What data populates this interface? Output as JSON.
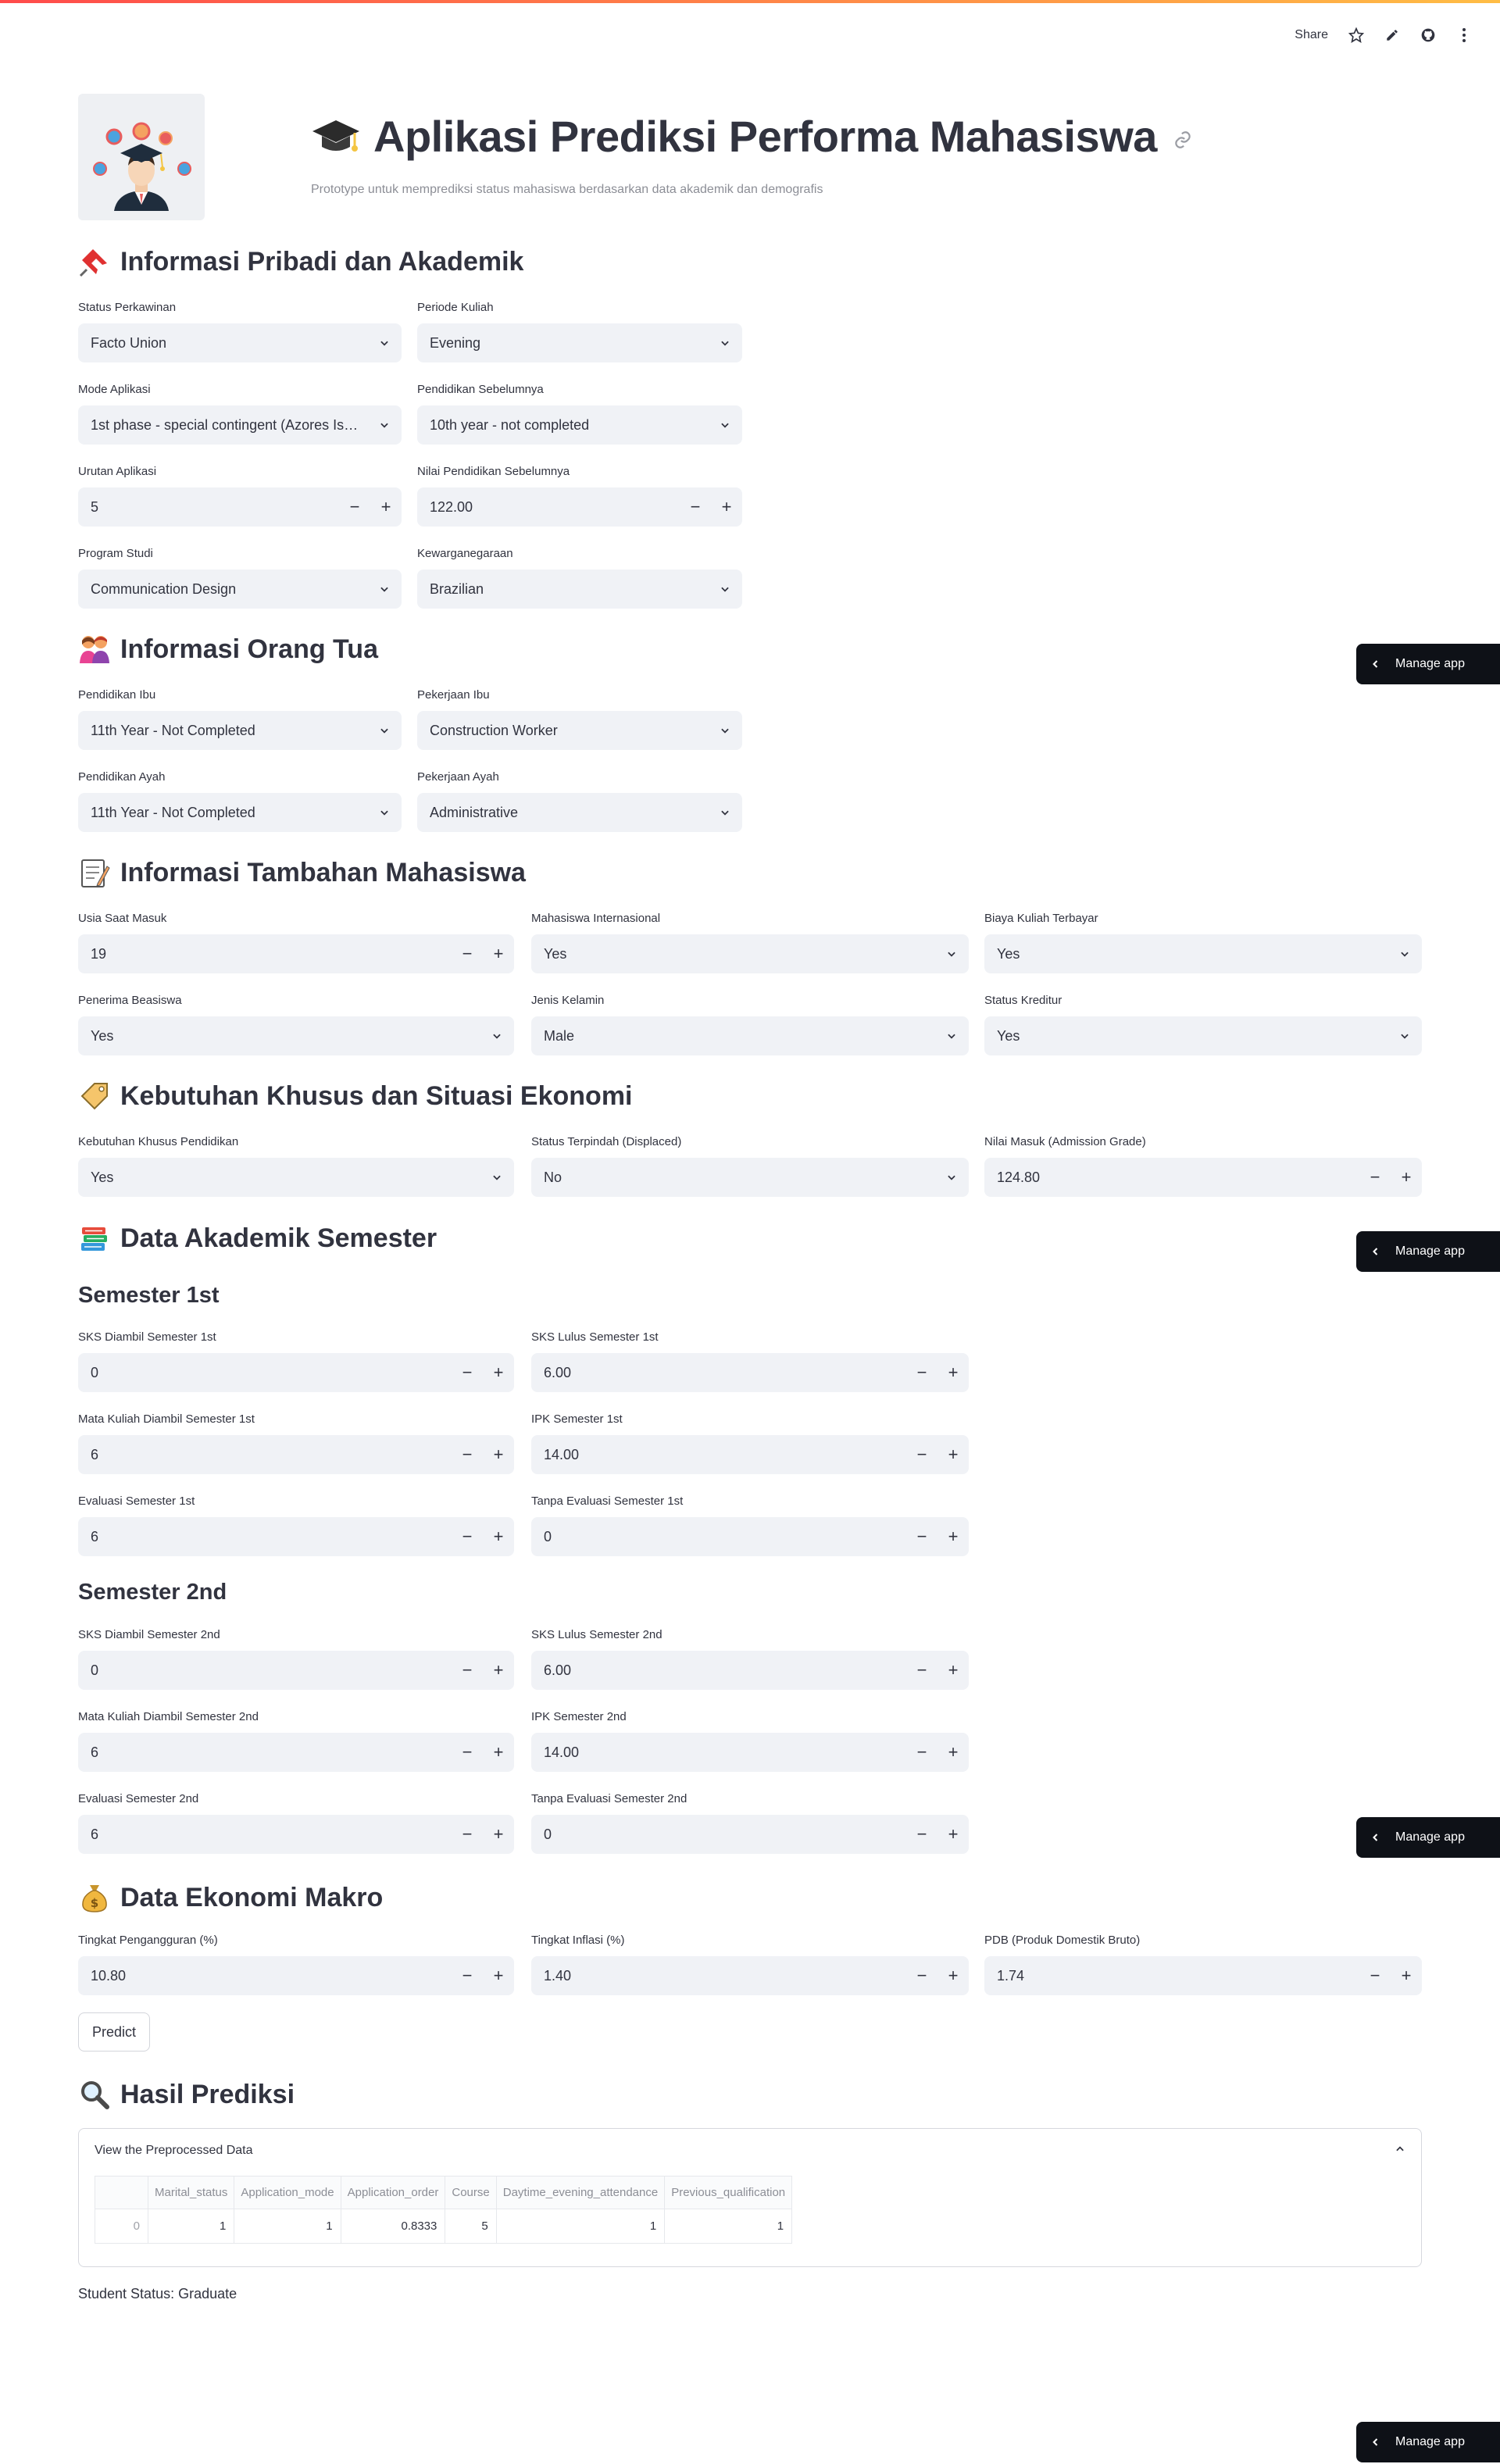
{
  "header": {
    "share_label": "Share",
    "title": "Aplikasi Prediksi Performa Mahasiswa",
    "subtitle": "Prototype untuk memprediksi status mahasiswa berdasarkan data akademik dan demografis"
  },
  "manage_app_label": "Manage app",
  "sections": {
    "pribadi": "Informasi Pribadi dan Akademik",
    "orangtua": "Informasi Orang Tua",
    "tambahan": "Informasi Tambahan Mahasiswa",
    "kebutuhan": "Kebutuhan Khusus dan Situasi Ekonomi",
    "akademik": "Data Akademik Semester",
    "ekonomi": "Data Ekonomi Makro",
    "hasil": "Hasil Prediksi"
  },
  "subsections": {
    "sem1": "Semester 1st",
    "sem2": "Semester 2nd"
  },
  "fields": {
    "status_perkawinan": {
      "label": "Status Perkawinan",
      "value": "Facto Union"
    },
    "periode_kuliah": {
      "label": "Periode Kuliah",
      "value": "Evening"
    },
    "mode_aplikasi": {
      "label": "Mode Aplikasi",
      "value": "1st phase - special contingent (Azores Island)"
    },
    "pendidikan_sebelumnya": {
      "label": "Pendidikan Sebelumnya",
      "value": "10th year - not completed"
    },
    "urutan_aplikasi": {
      "label": "Urutan Aplikasi",
      "value": "5"
    },
    "nilai_pendidikan_sebelumnya": {
      "label": "Nilai Pendidikan Sebelumnya",
      "value": "122.00"
    },
    "program_studi": {
      "label": "Program Studi",
      "value": "Communication Design"
    },
    "kewarganegaraan": {
      "label": "Kewarganegaraan",
      "value": "Brazilian"
    },
    "pendidikan_ibu": {
      "label": "Pendidikan Ibu",
      "value": "11th Year - Not Completed"
    },
    "pekerjaan_ibu": {
      "label": "Pekerjaan Ibu",
      "value": "Construction Worker"
    },
    "pendidikan_ayah": {
      "label": "Pendidikan Ayah",
      "value": "11th Year - Not Completed"
    },
    "pekerjaan_ayah": {
      "label": "Pekerjaan Ayah",
      "value": "Administrative"
    },
    "usia_saat_masuk": {
      "label": "Usia Saat Masuk",
      "value": "19"
    },
    "mahasiswa_internasional": {
      "label": "Mahasiswa Internasional",
      "value": "Yes"
    },
    "biaya_kuliah": {
      "label": "Biaya Kuliah Terbayar",
      "value": "Yes"
    },
    "penerima_beasiswa": {
      "label": "Penerima Beasiswa",
      "value": "Yes"
    },
    "jenis_kelamin": {
      "label": "Jenis Kelamin",
      "value": "Male"
    },
    "status_kreditur": {
      "label": "Status Kreditur",
      "value": "Yes"
    },
    "kebutuhan_khusus": {
      "label": "Kebutuhan Khusus Pendidikan",
      "value": "Yes"
    },
    "status_terpindah": {
      "label": "Status Terpindah (Displaced)",
      "value": "No"
    },
    "nilai_masuk": {
      "label": "Nilai Masuk (Admission Grade)",
      "value": "124.80"
    },
    "sks_diambil_1": {
      "label": "SKS Diambil Semester 1st",
      "value": "0"
    },
    "sks_lulus_1": {
      "label": "SKS Lulus Semester 1st",
      "value": "6.00"
    },
    "mk_diambil_1": {
      "label": "Mata Kuliah Diambil Semester 1st",
      "value": "6"
    },
    "ipk_1": {
      "label": "IPK Semester 1st",
      "value": "14.00"
    },
    "evaluasi_1": {
      "label": "Evaluasi Semester 1st",
      "value": "6"
    },
    "tanpa_evaluasi_1": {
      "label": "Tanpa Evaluasi Semester 1st",
      "value": "0"
    },
    "sks_diambil_2": {
      "label": "SKS Diambil Semester 2nd",
      "value": "0"
    },
    "sks_lulus_2": {
      "label": "SKS Lulus Semester 2nd",
      "value": "6.00"
    },
    "mk_diambil_2": {
      "label": "Mata Kuliah Diambil Semester 2nd",
      "value": "6"
    },
    "ipk_2": {
      "label": "IPK Semester 2nd",
      "value": "14.00"
    },
    "evaluasi_2": {
      "label": "Evaluasi Semester 2nd",
      "value": "6"
    },
    "tanpa_evaluasi_2": {
      "label": "Tanpa Evaluasi Semester 2nd",
      "value": "0"
    },
    "pengangguran": {
      "label": "Tingkat Pengangguran (%)",
      "value": "10.80"
    },
    "inflasi": {
      "label": "Tingkat Inflasi (%)",
      "value": "1.40"
    },
    "pdb": {
      "label": "PDB (Produk Domestik Bruto)",
      "value": "1.74"
    }
  },
  "predict_label": "Predict",
  "expander": {
    "title": "View the Preprocessed Data",
    "columns": [
      "Marital_status",
      "Application_mode",
      "Application_order",
      "Course",
      "Daytime_evening_attendance",
      "Previous_qualification"
    ],
    "rows": [
      {
        "index": "0",
        "cells": [
          "1",
          "1",
          "0.8333",
          "5",
          "1",
          "1"
        ]
      }
    ]
  },
  "result_text": "Student Status: Graduate",
  "colors": {
    "accent": "#ff4b4b",
    "input_bg": "#f0f2f6",
    "manage_bg": "#0e1117",
    "text": "#31333f"
  }
}
